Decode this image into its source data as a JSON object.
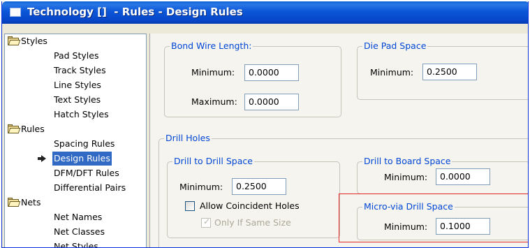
{
  "window": {
    "title": "Technology []  - Rules - Design Rules"
  },
  "tree": {
    "items": [
      {
        "label": "Styles",
        "type": "folder"
      },
      {
        "label": "Pad Styles"
      },
      {
        "label": "Track Styles"
      },
      {
        "label": "Line Styles"
      },
      {
        "label": "Text Styles"
      },
      {
        "label": "Hatch Styles"
      },
      {
        "label": "Rules",
        "type": "folder"
      },
      {
        "label": "Spacing Rules"
      },
      {
        "label": "Design Rules",
        "selected": true
      },
      {
        "label": "DFM/DFT Rules"
      },
      {
        "label": "Differential Pairs"
      },
      {
        "label": "Nets",
        "type": "folder"
      },
      {
        "label": "Net Names"
      },
      {
        "label": "Net Classes"
      },
      {
        "label": "Net Styles"
      }
    ]
  },
  "bond_wire_length": {
    "label": "Bond Wire Length:",
    "minimum_label": "Minimum:",
    "minimum_value": "0.0000",
    "maximum_label": "Maximum:",
    "maximum_value": "0.0000"
  },
  "die_pad_space": {
    "label": "Die Pad Space",
    "minimum_label": "Minimum:",
    "minimum_value": "0.2500"
  },
  "drill_holes": {
    "label": "Drill Holes",
    "drill_to_drill": {
      "label": "Drill to Drill Space",
      "minimum_label": "Minimum:",
      "minimum_value": "0.2500",
      "allow_coincident_label": "Allow Coincident Holes",
      "only_same_size_label": "Only If Same Size"
    },
    "drill_to_board": {
      "label": "Drill to Board Space",
      "minimum_label": "Minimum:",
      "minimum_value": "0.0000"
    },
    "micro_via": {
      "label": "Micro-via Drill Space",
      "minimum_label": "Minimum:",
      "minimum_value": "0.1000"
    }
  },
  "colors": {
    "title_bar": "#0b56d8",
    "group_label": "#0046d5",
    "selection": "#316ac5",
    "highlight_box": "#e22525"
  }
}
